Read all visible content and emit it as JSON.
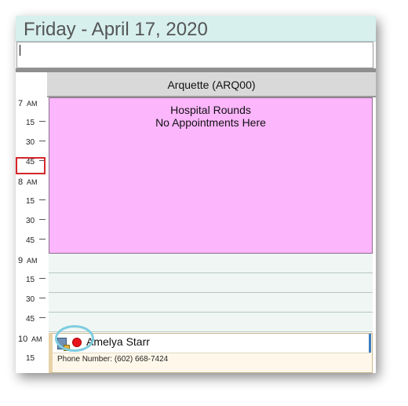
{
  "header": {
    "date_title": "Friday - April 17, 2020"
  },
  "note_input": {
    "value": ""
  },
  "provider_column": {
    "label": "Arquette (ARQ00)"
  },
  "time_slots": [
    {
      "hour": "7",
      "ampm": "AM",
      "minute": ""
    },
    {
      "hour": "",
      "ampm": "",
      "minute": "15"
    },
    {
      "hour": "",
      "ampm": "",
      "minute": "30"
    },
    {
      "hour": "",
      "ampm": "",
      "minute": "45"
    },
    {
      "hour": "8",
      "ampm": "AM",
      "minute": ""
    },
    {
      "hour": "",
      "ampm": "",
      "minute": "15"
    },
    {
      "hour": "",
      "ampm": "",
      "minute": "30"
    },
    {
      "hour": "",
      "ampm": "",
      "minute": "45"
    },
    {
      "hour": "9",
      "ampm": "AM",
      "minute": ""
    },
    {
      "hour": "",
      "ampm": "",
      "minute": "15"
    },
    {
      "hour": "",
      "ampm": "",
      "minute": "30"
    },
    {
      "hour": "",
      "ampm": "",
      "minute": "45"
    },
    {
      "hour": "10",
      "ampm": "AM",
      "minute": ""
    },
    {
      "hour": "",
      "ampm": "",
      "minute": "15"
    }
  ],
  "blocked_time": {
    "line1": "Hospital Rounds",
    "line2": "No Appointments Here",
    "color": "#fcb6fc"
  },
  "appointment": {
    "patient_name": "Amelya Starr",
    "phone": "Phone Number: (602) 668-7424",
    "icons": [
      "patient-card-icon",
      "status-red-dot-icon"
    ]
  },
  "colors": {
    "header_bg": "#d7f0ee",
    "selection_outline": "#d6262b",
    "highlight_ring": "#7ecde0",
    "open_slot": "#eff6f3"
  }
}
